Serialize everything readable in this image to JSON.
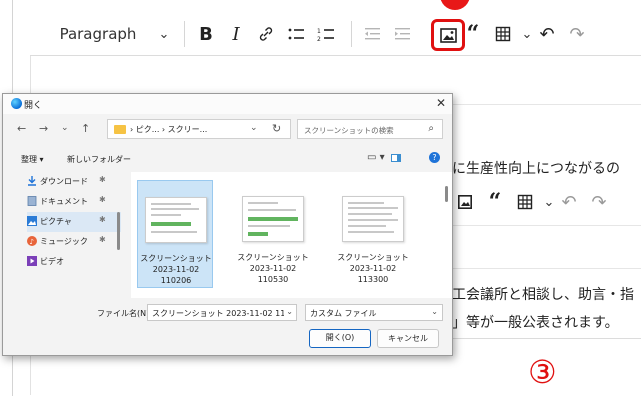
{
  "editor": {
    "paragraph_label": "Paragraph",
    "toolbar_icons": [
      "bold-icon",
      "italic-icon",
      "link-icon",
      "bulleted-list-icon",
      "numbered-list-icon",
      "outdent-icon",
      "indent-icon",
      "insert-image-icon",
      "blockquote-icon",
      "table-icon",
      "undo-icon",
      "redo-icon"
    ],
    "bg_text1": "に生産性向上につながるの",
    "bg_text2": "工会議所と相談し、助言・指",
    "bg_text3": "」等が一般公表されます。",
    "marker_label": "③",
    "highlight_color": "#e01010"
  },
  "dialog": {
    "title": "開く",
    "address_crumbs": "› ピク... › スクリー...",
    "search_placeholder": "スクリーンショットの検索",
    "organize_label": "整理 ▾",
    "new_folder_label": "新しいフォルダー",
    "nav_items": [
      {
        "label": "ダウンロード",
        "icon": "download-icon"
      },
      {
        "label": "ドキュメント",
        "icon": "document-icon"
      },
      {
        "label": "ピクチャ",
        "icon": "pictures-icon"
      },
      {
        "label": "ミュージック",
        "icon": "music-icon"
      },
      {
        "label": "ビデオ",
        "icon": "video-icon"
      }
    ],
    "files": [
      {
        "line1": "スクリーンショット",
        "line2": "2023-11-02",
        "line3": "110206"
      },
      {
        "line1": "スクリーンショット",
        "line2": "2023-11-02",
        "line3": "110530"
      },
      {
        "line1": "スクリーンショット",
        "line2": "2023-11-02",
        "line3": "113300"
      }
    ],
    "filename_label": "ファイル名(N):",
    "filename_value": "スクリーンショット 2023-11-02 11020",
    "filetype_value": "カスタム ファイル",
    "open_button": "開く(O)",
    "cancel_button": "キャンセル"
  }
}
